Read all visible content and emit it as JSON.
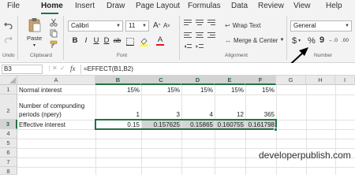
{
  "menu": {
    "tabs": [
      "File",
      "Home",
      "Insert",
      "Draw",
      "Page Layout",
      "Formulas",
      "Data",
      "Review",
      "View",
      "Help"
    ],
    "active_tab": "Home"
  },
  "ribbon": {
    "undo_label": "Undo",
    "clipboard": {
      "paste_label": "Paste",
      "group_label": "Clipboard"
    },
    "font": {
      "name": "Calibri",
      "size": "11",
      "grow_label": "A",
      "shrink_label": "A",
      "bold": "B",
      "italic": "I",
      "underline": "U",
      "double_underline": "D",
      "strike": "ab",
      "color_label": "A",
      "group_label": "Font"
    },
    "alignment": {
      "wrap_text": "Wrap Text",
      "merge_center": "Merge & Center",
      "group_label": "Alignment"
    },
    "number": {
      "format": "General",
      "currency": "$",
      "percent": "%",
      "comma": "9",
      "inc_decimal": "←.0",
      "dec_decimal": ".00",
      "group_label": "Number"
    }
  },
  "formula_bar": {
    "name_box": "B3",
    "fx": "fx",
    "formula": "=EFFECT(B1,B2)"
  },
  "sheet": {
    "columns": [
      "A",
      "B",
      "C",
      "D",
      "E",
      "F",
      "G",
      "H",
      "I"
    ],
    "rows": [
      "1",
      "2",
      "3",
      "4",
      "5",
      "6",
      "7",
      "8"
    ],
    "cells": {
      "A1": "Normal interest",
      "B1": "15%",
      "C1": "15%",
      "D1": "15%",
      "E1": "15%",
      "F1": "15%",
      "A2a": "Number of compunding",
      "A2b": "periods (npery)",
      "B2": "1",
      "C2": "3",
      "D2": "4",
      "E2": "12",
      "F2": "365",
      "A3": "Effective interest",
      "B3": "0.15",
      "C3": "0.157625",
      "D3": "0.15865",
      "E3": "0.160755",
      "F3": "0.161798"
    }
  },
  "watermark": "developerpublish.com",
  "colors": {
    "accent": "#217346",
    "selection_fill": "#d4d4d4",
    "arrow": "#000000"
  }
}
